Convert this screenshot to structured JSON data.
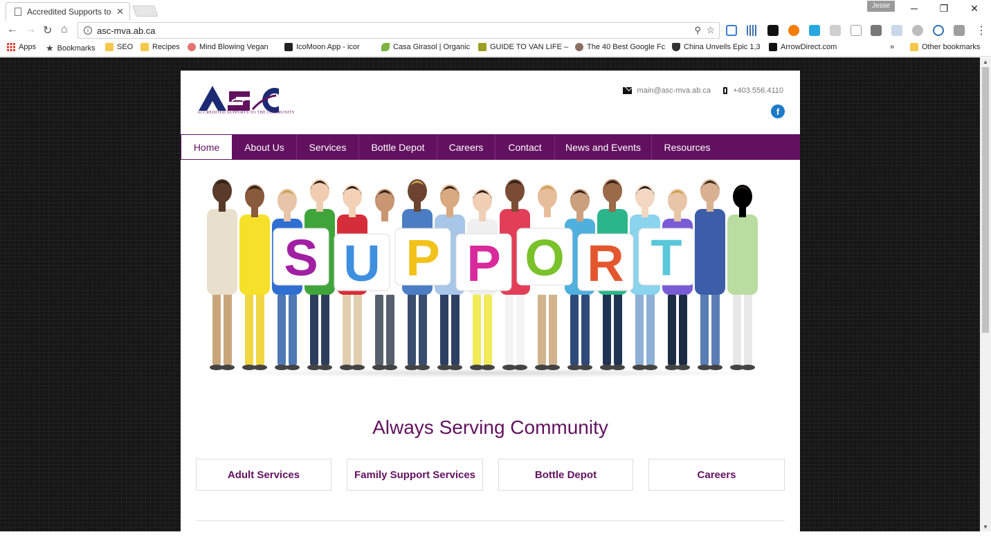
{
  "browser": {
    "tab_title": "Accredited Supports to t",
    "tab_close": "✕",
    "profile_name": "Jesse",
    "url": "asc-mva.ab.ca",
    "window_controls": {
      "minimize": "─",
      "restore": "❐",
      "close": "✕"
    },
    "nav": {
      "back": "←",
      "forward": "→",
      "reload": "↻",
      "home": "⌂"
    },
    "menu": "⋮",
    "bookmarks": [
      {
        "label": "Apps",
        "icon": "apps-grid-icon",
        "color": "#d93025"
      },
      {
        "label": "Bookmarks",
        "icon": "star-icon",
        "color": "#444444"
      },
      {
        "label": "SEO",
        "icon": "folder-icon",
        "color": "#f5c84c"
      },
      {
        "label": "Recipes",
        "icon": "folder-icon",
        "color": "#f5c84c"
      },
      {
        "label": "Mind Blowing Vegan",
        "icon": "lips-icon",
        "color": "#e57373"
      },
      {
        "label": "IcoMoon App - icor",
        "icon": "icomoon-icon",
        "color": "#222222"
      },
      {
        "label": "Casa Girasol | Organic",
        "icon": "leaf-icon",
        "color": "#7cb342"
      },
      {
        "label": "GUIDE TO VAN LIFE –",
        "icon": "page-icon",
        "color": "#9e9d24"
      },
      {
        "label": "The 40 Best Google Fc",
        "icon": "circle-icon",
        "color": "#8d6e63"
      },
      {
        "label": "China Unveils Epic 1,3",
        "icon": "shield-icon",
        "color": "#333333"
      },
      {
        "label": "ArrowDirect.com",
        "icon": "arrow-logo-icon",
        "color": "#111111"
      }
    ],
    "bookmarks_overflow": "»",
    "other_bookmarks": "Other bookmarks"
  },
  "site": {
    "logo_letters": "ASC",
    "logo_tagline": "ACCREDITED SUPPORTS TO THE COMMUNITY",
    "email": "main@asc-mva.ab.ca",
    "phone": "+403.556.4110",
    "facebook": "f",
    "brand_color": "#62115f",
    "nav": [
      {
        "label": "Home",
        "active": true
      },
      {
        "label": "About Us",
        "active": false
      },
      {
        "label": "Services",
        "active": false
      },
      {
        "label": "Bottle Depot",
        "active": false
      },
      {
        "label": "Careers",
        "active": false
      },
      {
        "label": "Contact",
        "active": false
      },
      {
        "label": "News and Events",
        "active": false
      },
      {
        "label": "Resources",
        "active": false
      }
    ],
    "hero_letters": [
      {
        "char": "S",
        "color": "#a11fa3"
      },
      {
        "char": "U",
        "color": "#3f8fe0"
      },
      {
        "char": "P",
        "color": "#f2c21b"
      },
      {
        "char": "P",
        "color": "#d82a9c"
      },
      {
        "char": "O",
        "color": "#79c22a"
      },
      {
        "char": "R",
        "color": "#e4572e"
      },
      {
        "char": "T",
        "color": "#5ac7d9"
      }
    ],
    "heading": "Always Serving Community",
    "service_buttons": [
      "Adult Services",
      "Family Support Services",
      "Bottle Depot",
      "Careers"
    ]
  }
}
